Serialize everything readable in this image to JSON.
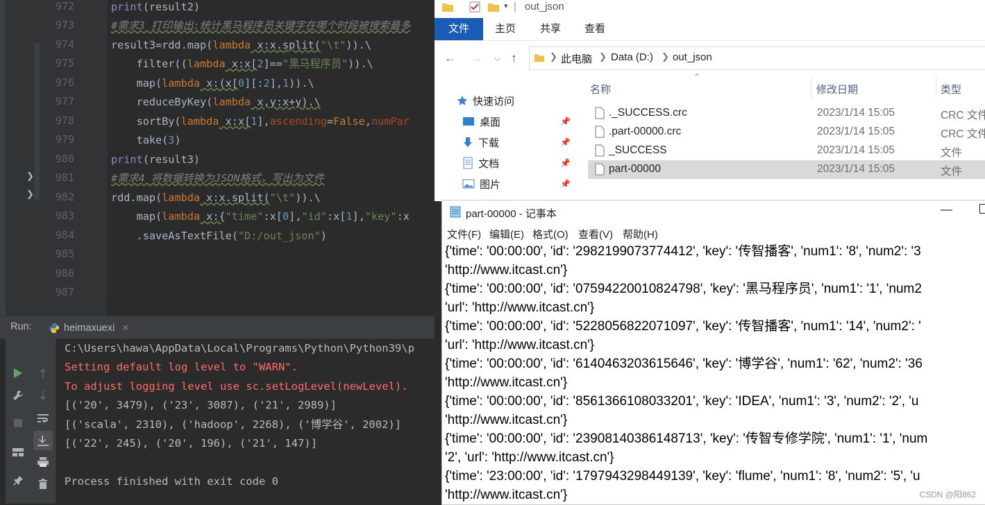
{
  "editor": {
    "line_numbers": [
      "972",
      "973",
      "974",
      "975",
      "976",
      "977",
      "978",
      "979",
      "980",
      "981",
      "982",
      "983",
      "984",
      "985",
      "986",
      "987"
    ],
    "lines": {
      "l972": {
        "a": "print",
        "b": "(result2)"
      },
      "l973": {
        "a": "#需求3 打印输出:统计黑马程序员关键字在哪个时段被搜索最多"
      },
      "l974": {
        "a": "result3=rdd.map(",
        "b": "lambda",
        "c": " x:x.split(",
        "d": "\"\\t\"",
        "e": ")).\\"
      },
      "l975": {
        "a": "    filter((",
        "b": "lambda",
        "c": " x:x[",
        "d": "2",
        "e": "]==",
        "f": "\"黑马程序员\"",
        "g": ")).\\"
      },
      "l976": {
        "a": "    map(",
        "b": "lambda",
        "c": " x:(x[",
        "d": "0",
        "e": "][:",
        "f": "2",
        "g": "],",
        "h": "1",
        "i": ")).\\"
      },
      "l977": {
        "a": "    reduceByKey(",
        "b": "lambda",
        "c": " x,y:x+y).\\"
      },
      "l978": {
        "a": "    sortBy(",
        "b": "lambda",
        "c": " x:x[",
        "d": "1",
        "e": "],",
        "f": "ascending",
        "g": "=",
        "h": "False",
        ",": ",",
        "i": "numPar"
      },
      "l979": {
        "a": "    take(",
        "b": "3",
        "c": ")"
      },
      "l980": {
        "a": "print",
        "b": "(result3)"
      },
      "l981": {
        "a": "#需求4 将数据转换为JSON格式，写出为文件"
      },
      "l982": {
        "a": "rdd.map(",
        "b": "lambda",
        "c": " x:x.split(",
        "d": "\"\\t\"",
        "e": ")).\\"
      },
      "l983": {
        "a": "    map(",
        "b": "lambda",
        "c": " x:{",
        "d": "\"time\"",
        "e": ":x[",
        "f": "0",
        "g": "],",
        "h": "\"id\"",
        "i": ":x[",
        "j": "1",
        "k": "],",
        "l": "\"key\"",
        "m": ":x"
      },
      "l984": {
        "a": "    .saveAsTextFile(",
        "b": "\"D:/out_json\"",
        "c": ")"
      }
    }
  },
  "run": {
    "label": "Run:",
    "tab_name": "heimaxuexi",
    "output": [
      "C:\\Users\\hawa\\AppData\\Local\\Programs\\Python\\Python39\\p",
      "Setting default log level to \"WARN\".",
      "To adjust logging level use sc.setLogLevel(newLevel).",
      "[('20', 3479), ('23', 3087), ('21', 2989)]",
      "[('scala', 2310), ('hadoop', 2268), ('博学谷', 2002)]",
      "[('22', 245), ('20', 196), ('21', 147)]",
      "",
      "Process finished with exit code 0"
    ]
  },
  "explorer": {
    "window_title": "out_json",
    "ribbon_tabs": [
      "文件",
      "主页",
      "共享",
      "查看"
    ],
    "breadcrumb": [
      "此电脑",
      "Data (D:)",
      "out_json"
    ],
    "nav": [
      "快速访问",
      "桌面",
      "下载",
      "文档",
      "图片"
    ],
    "columns": {
      "name": "名称",
      "date": "修改日期",
      "type": "类型"
    },
    "files": [
      {
        "name": "._SUCCESS.crc",
        "date": "2023/1/14 15:05",
        "type": "CRC 文件"
      },
      {
        "name": ".part-00000.crc",
        "date": "2023/1/14 15:05",
        "type": "CRC 文件"
      },
      {
        "name": "_SUCCESS",
        "date": "2023/1/14 15:05",
        "type": "文件"
      },
      {
        "name": "part-00000",
        "date": "2023/1/14 15:05",
        "type": "文件"
      }
    ]
  },
  "notepad": {
    "title": "part-00000 - 记事本",
    "menu": [
      "文件(F)",
      "编辑(E)",
      "格式(O)",
      "查看(V)",
      "帮助(H)"
    ],
    "lines": [
      "{'time': '00:00:00', 'id': '2982199073774412', 'key': '传智播客', 'num1': '8', 'num2': '3",
      "'http://www.itcast.cn'}",
      "{'time': '00:00:00', 'id': '07594220010824798', 'key': '黑马程序员', 'num1': '1', 'num2",
      "'url': 'http://www.itcast.cn'}",
      "{'time': '00:00:00', 'id': '5228056822071097', 'key': '传智播客', 'num1': '14', 'num2': '",
      "'url': 'http://www.itcast.cn'}",
      "{'time': '00:00:00', 'id': '6140463203615646', 'key': '博学谷', 'num1': '62', 'num2': '36",
      "'http://www.itcast.cn'}",
      "{'time': '00:00:00', 'id': '8561366108033201', 'key': 'IDEA', 'num1': '3', 'num2': '2', 'u",
      "'http://www.itcast.cn'}",
      "{'time': '00:00:00', 'id': '23908140386148713', 'key': '传智专修学院', 'num1': '1', 'num",
      "'2', 'url': 'http://www.itcast.cn'}",
      "{'time': '23:00:00', 'id': '1797943298449139', 'key': 'flume', 'num1': '8', 'num2': '5', 'u",
      "'http://www.itcast.cn'}"
    ]
  },
  "watermark": "CSDN @阳862"
}
